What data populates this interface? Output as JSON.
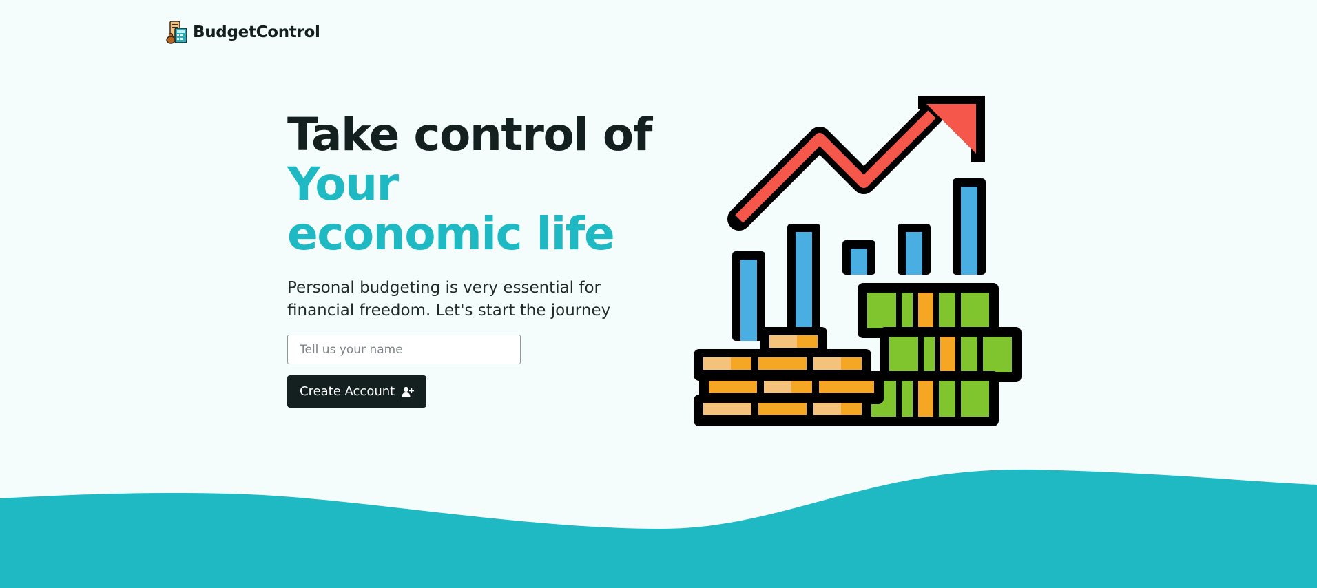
{
  "brand": {
    "name": "BudgetControl",
    "logo_icon": "budget-calculator-icon"
  },
  "hero": {
    "headline_line1": "Take control of",
    "headline_line2": "Your economic life",
    "subtitle": "Personal budgeting is very essential for financial freedom. Let's start the journey",
    "name_input": {
      "value": "",
      "placeholder": "Tell us your name"
    },
    "create_button": {
      "label": "Create Account",
      "icon": "user-plus-icon"
    }
  },
  "illustration": {
    "icon": "finance-growth-chart-icon"
  },
  "colors": {
    "background": "#f5fcfc",
    "accent": "#1eb9c3",
    "dark": "#14201f",
    "wave": "#1eb9c3"
  }
}
